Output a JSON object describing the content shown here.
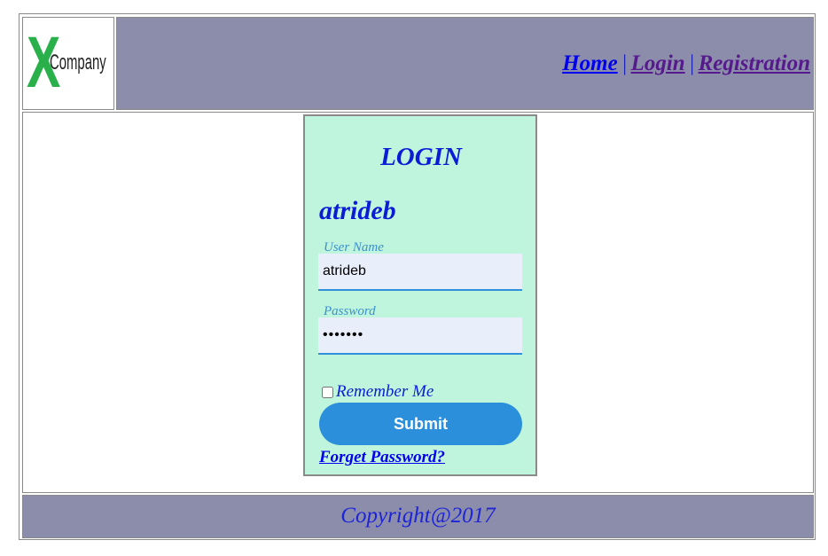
{
  "logo": {
    "letter": "X",
    "text": "Company",
    "icon": "company-logo",
    "color": "#29b04a"
  },
  "nav": {
    "items": [
      {
        "label": "Home"
      },
      {
        "label": "Login"
      },
      {
        "label": "Registration"
      }
    ],
    "separator": "|"
  },
  "login": {
    "title": "LOGIN",
    "username_display": "atrideb",
    "username_label": "User Name",
    "username_value": "atrideb",
    "password_label": "Password",
    "password_value": "1234567",
    "remember_label": "Remember Me",
    "remember_checked": false,
    "submit_label": "Submit",
    "forgot_label": "Forget Password?"
  },
  "footer": {
    "copyright": "Copyright@2017"
  },
  "colors": {
    "header_bg": "#8c8dab",
    "panel_bg": "#c0f5dd",
    "accent": "#2c8fdc",
    "title_blue": "#0b1cd6"
  }
}
